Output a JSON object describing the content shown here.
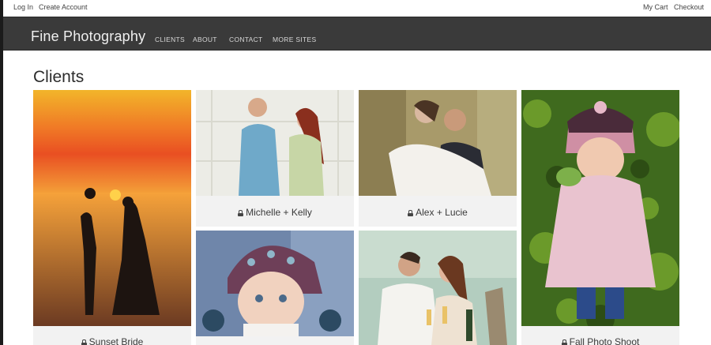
{
  "topbar": {
    "login": "Log In",
    "create_account": "Create Account",
    "my_cart": "My Cart",
    "checkout": "Checkout"
  },
  "navbar": {
    "brand": "Fine Photography",
    "links": [
      "CLIENTS",
      "ABOUT",
      "CONTACT",
      "MORE SITES"
    ]
  },
  "main": {
    "title": "Clients",
    "galleries": [
      {
        "caption": "Sunset Bride",
        "locked": true
      },
      {
        "caption": "Michelle + Kelly",
        "locked": true
      },
      {
        "caption": "Alex + Lucie",
        "locked": true
      },
      {
        "caption": "Fall Photo Shoot",
        "locked": true
      },
      {
        "caption": "",
        "locked": false
      },
      {
        "caption": "",
        "locked": false
      }
    ]
  },
  "colors": {
    "navbar": "#3a3a3a",
    "page": "#ffffff",
    "card": "#f2f2f2"
  },
  "icons": {
    "lock": "lock-icon"
  }
}
